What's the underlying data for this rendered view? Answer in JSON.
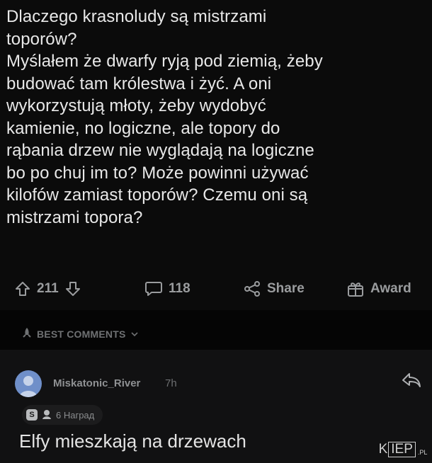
{
  "post": {
    "text": "Dlaczego krasnoludy są mistrzami\ntoporów?\nMyślałem że dwarfy ryją pod ziemią, żeby\nbudować tam królestwa i żyć. A oni\nwykorzystują młoty, żeby wydobyć\nkamienie, no logiczne, ale topory do\nrąbania drzew nie wyglądają na logiczne\nbo po chuj im to? Może powinni używać\nkilofów zamiast toporów? Czemu oni są\nmistrzami topora?"
  },
  "actions": {
    "votes": "211",
    "comments": "118",
    "share_label": "Share",
    "award_label": "Award",
    "icons": [
      "upvote-icon",
      "downvote-icon",
      "comment-icon",
      "share-icon",
      "award-icon"
    ]
  },
  "sort": {
    "label": "BEST COMMENTS",
    "icon": "rocket-icon"
  },
  "comment": {
    "username": "Miskatonic_River",
    "time": "7h",
    "awards_label": "6 Наград",
    "text": "Elfy mieszkają na drzewach"
  },
  "watermark": {
    "left": "K",
    "box": "IEP",
    "suffix": ".PL"
  },
  "colors": {
    "background": "#0b0b0b",
    "text": "#e8e8e8",
    "muted": "#9a9c9e",
    "avatar": "#6f8fc9"
  }
}
